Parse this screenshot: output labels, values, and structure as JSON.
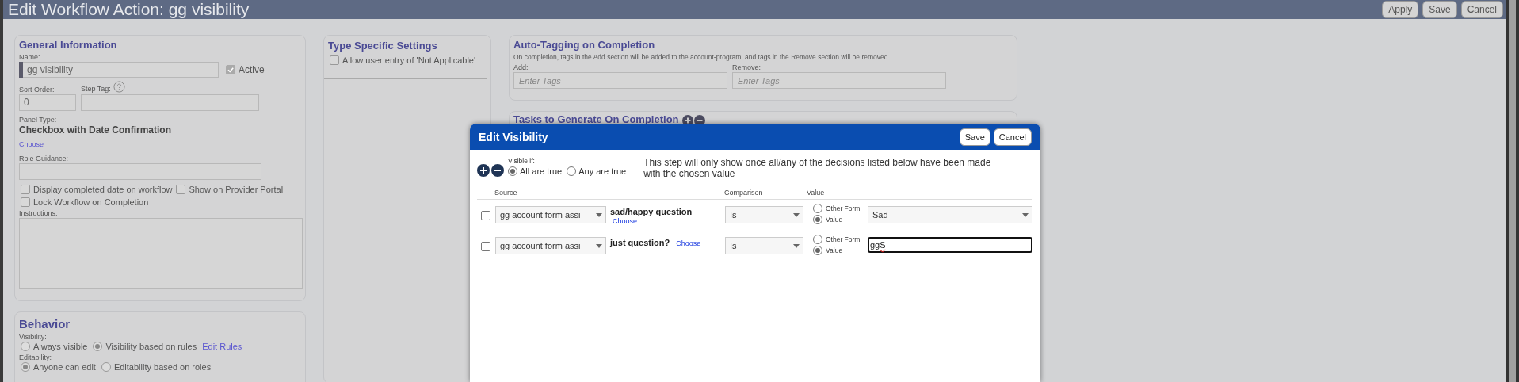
{
  "window": {
    "title": "Edit Workflow Action: gg visibility",
    "buttons": [
      "Apply",
      "Save",
      "Cancel"
    ]
  },
  "general_information": {
    "title": "General Information",
    "name_label": "Name:",
    "name_value": "gg visibility",
    "active": {
      "label": "Active",
      "checked": true
    },
    "sort_order_label": "Sort Order:",
    "sort_order_value": "0",
    "step_tag_label": "Step Tag:",
    "panel_type_label": "Panel Type:",
    "panel_type_value": "Checkbox with Date Confirmation",
    "choose_link": "Choose",
    "role_guidance_label": "Role Guidance:",
    "options": [
      {
        "label": "Display completed date on workflow",
        "checked": false
      },
      {
        "label": "Show on Provider Portal",
        "checked": false
      },
      {
        "label": "Lock Workflow on Completion",
        "checked": false
      }
    ],
    "instructions_label": "Instructions:"
  },
  "behavior": {
    "title": "Behavior",
    "visibility_label": "Visibility:",
    "visibility_options": [
      {
        "label": "Always visible",
        "selected": false
      },
      {
        "label": "Visibility based on rules",
        "selected": true
      }
    ],
    "edit_rules_link": "Edit Rules",
    "editability_label": "Editability:",
    "editability_options": [
      {
        "label": "Anyone can edit",
        "selected": true
      },
      {
        "label": "Editability based on roles",
        "selected": false
      }
    ]
  },
  "type_specific_settings": {
    "title": "Type Specific Settings",
    "options": [
      {
        "label": "Allow user entry of 'Not Applicable'",
        "checked": false
      }
    ]
  },
  "auto_tagging": {
    "title": "Auto-Tagging on Completion",
    "description": "On completion, tags in the Add section will be added to the account-program, and tags in the Remove section will be removed.",
    "fields": [
      {
        "label": "Add:",
        "placeholder": "Enter Tags"
      },
      {
        "label": "Remove:",
        "placeholder": "Enter Tags"
      }
    ]
  },
  "tasks_panel": {
    "title": "Tasks to Generate On Completion"
  },
  "dialog": {
    "title": "Edit Visibility",
    "buttons": [
      "Save",
      "Cancel"
    ],
    "visible_if_label": "Visible if:",
    "visible_if_options": [
      {
        "label": "All are true",
        "selected": true
      },
      {
        "label": "Any are true",
        "selected": false
      }
    ],
    "description": "This step will only show once all/any of the decisions listed below have been made with the chosen value",
    "columns": [
      "Source",
      "Comparison",
      "Value"
    ],
    "rules": [
      {
        "checked": false,
        "source": "gg account form assi",
        "question": "sad/happy question",
        "choose": "Choose",
        "comparison": "Is",
        "value_options": [
          {
            "label": "Other Form",
            "selected": false
          },
          {
            "label": "Value",
            "selected": true
          }
        ],
        "kind": "select",
        "value": "Sad",
        "focused": false
      },
      {
        "checked": false,
        "source": "gg account form assi",
        "question": "just question?",
        "choose": "Choose",
        "comparison": "Is",
        "value_options": [
          {
            "label": "Other Form",
            "selected": false
          },
          {
            "label": "Value",
            "selected": true
          }
        ],
        "kind": "input",
        "value": "ggS",
        "focused": true
      }
    ]
  }
}
